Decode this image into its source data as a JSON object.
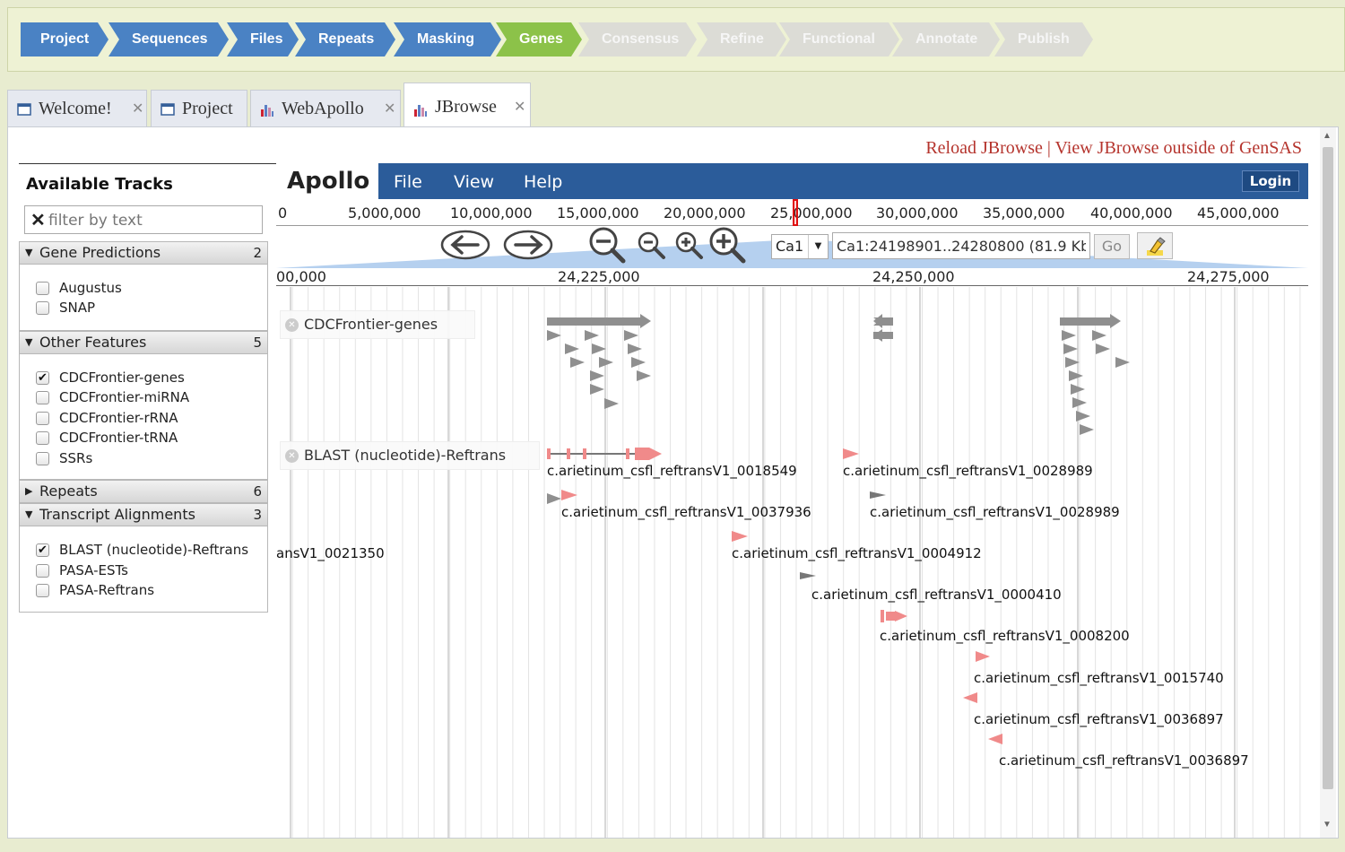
{
  "workflow": {
    "steps": [
      {
        "label": "Project",
        "state": "done"
      },
      {
        "label": "Sequences",
        "state": "done"
      },
      {
        "label": "Files",
        "state": "done"
      },
      {
        "label": "Repeats",
        "state": "done"
      },
      {
        "label": "Masking",
        "state": "done"
      },
      {
        "label": "Genes",
        "state": "current"
      },
      {
        "label": "Consensus",
        "state": "todo"
      },
      {
        "label": "Refine",
        "state": "todo"
      },
      {
        "label": "Functional",
        "state": "todo"
      },
      {
        "label": "Annotate",
        "state": "todo"
      },
      {
        "label": "Publish",
        "state": "todo"
      }
    ]
  },
  "tabs": [
    {
      "label": "Welcome!",
      "icon": "window-icon",
      "closable": true
    },
    {
      "label": "Project",
      "icon": "window-icon",
      "closable": false
    },
    {
      "label": "WebApollo",
      "icon": "bar-chart-icon",
      "closable": true
    },
    {
      "label": "JBrowse",
      "icon": "bar-chart-icon",
      "closable": true,
      "active": true
    }
  ],
  "links": {
    "reload": "Reload JBrowse",
    "separator": "|",
    "outside": "View JBrowse outside of GenSAS"
  },
  "tracks_panel": {
    "title": "Available Tracks",
    "filter_placeholder": "filter by text",
    "categories": [
      {
        "label": "Gene Predictions",
        "count": "2",
        "expanded": true,
        "tracks": [
          {
            "label": "Augustus",
            "checked": false
          },
          {
            "label": "SNAP",
            "checked": false
          }
        ]
      },
      {
        "label": "Other Features",
        "count": "5",
        "expanded": true,
        "tracks": [
          {
            "label": "CDCFrontier-genes",
            "checked": true
          },
          {
            "label": "CDCFrontier-miRNA",
            "checked": false
          },
          {
            "label": "CDCFrontier-rRNA",
            "checked": false
          },
          {
            "label": "CDCFrontier-tRNA",
            "checked": false
          },
          {
            "label": "SSRs",
            "checked": false
          }
        ]
      },
      {
        "label": "Repeats",
        "count": "6",
        "expanded": false,
        "tracks": []
      },
      {
        "label": "Transcript Alignments",
        "count": "3",
        "expanded": true,
        "tracks": [
          {
            "label": "BLAST (nucleotide)-Reftrans",
            "checked": true
          },
          {
            "label": "PASA-ESTs",
            "checked": false
          },
          {
            "label": "PASA-Reftrans",
            "checked": false
          }
        ]
      }
    ]
  },
  "apollo": {
    "logo": "Apollo",
    "menu": [
      "File",
      "View",
      "Help"
    ],
    "login": "Login"
  },
  "overview_ticks": [
    "0",
    "5,000,000",
    "10,000,000",
    "15,000,000",
    "20,000,000",
    "25,000,000",
    "30,000,000",
    "35,000,000",
    "40,000,000",
    "45,000,000"
  ],
  "navigation": {
    "chromosome": "Ca1",
    "location": "Ca1:24198901..24280800 (81.9 Kb)",
    "go": "Go"
  },
  "scale_ticks": [
    "00,000",
    "24,225,000",
    "24,250,000",
    "24,275,000"
  ],
  "track_labels": {
    "genes": "CDCFrontier-genes",
    "blast": "BLAST (nucleotide)-Reftrans"
  },
  "blast_features": [
    {
      "label": "c.arietinum_csfl_reftransV1_0018549"
    },
    {
      "label": "c.arietinum_csfl_reftransV1_0028989"
    },
    {
      "label": "c.arietinum_csfl_reftransV1_0037936"
    },
    {
      "label": "c.arietinum_csfl_reftransV1_0028989"
    },
    {
      "label": "ansV1_0021350"
    },
    {
      "label": "c.arietinum_csfl_reftransV1_0004912"
    },
    {
      "label": "c.arietinum_csfl_reftransV1_0000410"
    },
    {
      "label": "c.arietinum_csfl_reftransV1_0008200"
    },
    {
      "label": "c.arietinum_csfl_reftransV1_0015740"
    },
    {
      "label": "c.arietinum_csfl_reftransV1_0036897"
    },
    {
      "label": "c.arietinum_csfl_reftransV1_0036897"
    }
  ],
  "colors": {
    "done": "#4a82c4",
    "current": "#8cc249",
    "todo": "#dcdcd6",
    "menubar": "#2b5c9a",
    "link": "#b5342d",
    "blast_feature": "#f08a8a",
    "gene_feature": "#8f8f8f"
  }
}
